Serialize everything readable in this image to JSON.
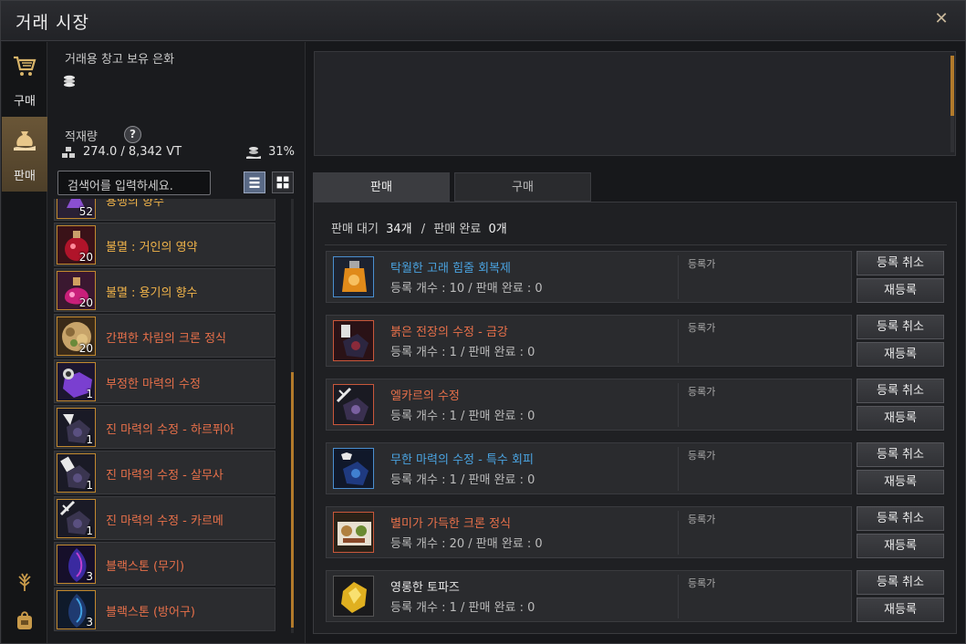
{
  "window": {
    "title": "거래 시장"
  },
  "rail": {
    "buy_label": "구매",
    "sell_label": "판매"
  },
  "left": {
    "currency_label": "거래용 창고 보유 은화",
    "weight_label": "적재량",
    "help_glyph": "?",
    "weight_value": "274.0 / 8,342 VT",
    "weight_percent": "31%",
    "search_placeholder": "검색어를 입력하세요.",
    "items": [
      {
        "name": "용맹의 향수",
        "qty": "52",
        "color": "#f0b34a"
      },
      {
        "name": "불멸 : 거인의 영약",
        "qty": "20",
        "color": "#f0b34a"
      },
      {
        "name": "불멸 : 용기의 향수",
        "qty": "20",
        "color": "#f0b34a"
      },
      {
        "name": "간편한 차림의 크론 정식",
        "qty": "20",
        "color": "#e8704a"
      },
      {
        "name": "부정한 마력의 수정",
        "qty": "1",
        "color": "#e8704a"
      },
      {
        "name": "진 마력의 수정 - 하르퓌아",
        "qty": "1",
        "color": "#e8704a"
      },
      {
        "name": "진 마력의 수정 - 살무사",
        "qty": "1",
        "color": "#e8704a"
      },
      {
        "name": "진 마력의 수정 - 카르메",
        "qty": "1",
        "color": "#e8704a"
      },
      {
        "name": "블랙스톤 (무기)",
        "qty": "3",
        "color": "#e8704a"
      },
      {
        "name": "블랙스톤 (방어구)",
        "qty": "3",
        "color": "#e8704a"
      }
    ]
  },
  "right": {
    "tabs": [
      {
        "label": "판매"
      },
      {
        "label": "구매"
      }
    ],
    "status": {
      "pending_label": "판매 대기",
      "pending_value": "34개",
      "sep": "/",
      "done_label": "판매 완료",
      "done_value": "0개"
    },
    "price_label": "등록가",
    "cancel_label": "등록 취소",
    "relist_label": "재등록",
    "sales": [
      {
        "name": "탁월한 고래 힘줄 회복제",
        "info": "등록 개수 : 10 / 판매 완료 : 0",
        "color": "#4aa3e0",
        "border": "#4a8fd0"
      },
      {
        "name": "붉은 전장의 수정 - 금강",
        "info": "등록 개수 : 1 / 판매 완료 : 0",
        "color": "#e8704a",
        "border": "#c9573b"
      },
      {
        "name": "엘카르의 수정",
        "info": "등록 개수 : 1 / 판매 완료 : 0",
        "color": "#e8704a",
        "border": "#c9573b"
      },
      {
        "name": "무한 마력의 수정 - 특수 회피",
        "info": "등록 개수 : 1 / 판매 완료 : 0",
        "color": "#4aa3e0",
        "border": "#4a8fd0"
      },
      {
        "name": "별미가 가득한 크론 정식",
        "info": "등록 개수 : 20 / 판매 완료 : 0",
        "color": "#e8704a",
        "border": "#c9573b"
      },
      {
        "name": "영롱한 토파즈",
        "info": "등록 개수 : 1 / 판매 완료 : 0",
        "color": "#e6e6e6",
        "border": "#555555"
      }
    ]
  }
}
